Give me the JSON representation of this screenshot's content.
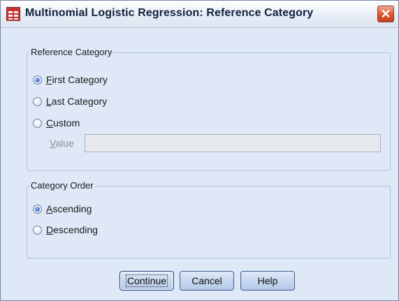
{
  "window": {
    "title": "Multinomial Logistic Regression: Reference Category",
    "close_symbol": "✕",
    "app_icon": "spss-data-grid-icon"
  },
  "reference_category": {
    "legend": "Reference Category",
    "options": [
      {
        "label": "First Category",
        "mnemonic": "F",
        "checked": true
      },
      {
        "label": "Last Category",
        "mnemonic": "L",
        "checked": false
      },
      {
        "label": "Custom",
        "mnemonic": "C",
        "checked": false
      }
    ],
    "value_label": "Value",
    "value_text": ""
  },
  "category_order": {
    "legend": "Category Order",
    "options": [
      {
        "label": "Ascending",
        "mnemonic": "A",
        "checked": true
      },
      {
        "label": "Descending",
        "mnemonic": "D",
        "checked": false
      }
    ]
  },
  "buttons": {
    "continue": "Continue",
    "cancel": "Cancel",
    "help": "Help"
  },
  "colors": {
    "dialog_background": "#dfe8f6",
    "title_text": "#10213f",
    "close_button": "#d9552d",
    "radio_selected": "#1f4fc4"
  }
}
